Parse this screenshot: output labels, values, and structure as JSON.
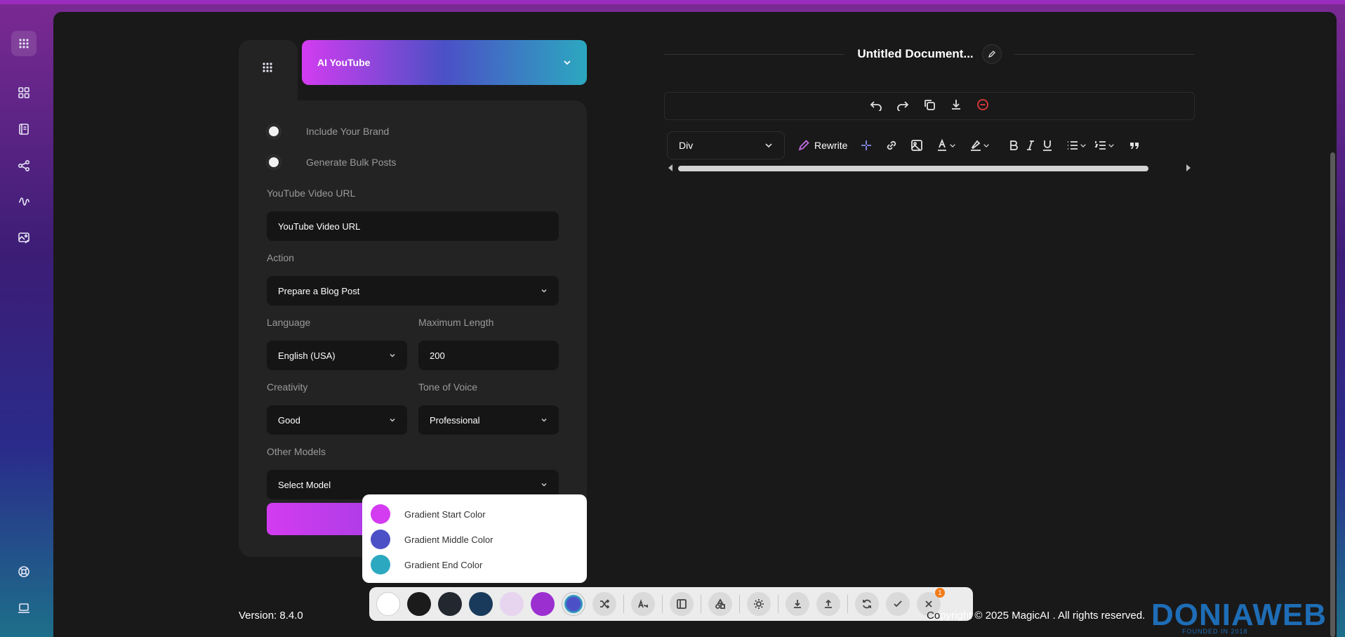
{
  "rail": {
    "icons": [
      "apps-icon",
      "grid-icon",
      "book-icon",
      "share-icon",
      "activity-icon",
      "image-edit-icon",
      "support-icon",
      "laptop-icon"
    ]
  },
  "generator": {
    "header_title": "AI YouTube",
    "toggles": [
      {
        "label": "Include Your Brand"
      },
      {
        "label": "Generate Bulk Posts"
      }
    ],
    "url_label": "YouTube Video URL",
    "url_value": "YouTube Video URL",
    "action_label": "Action",
    "action_value": "Prepare a Blog Post",
    "language_label": "Language",
    "language_value": "English (USA)",
    "maxlen_label": "Maximum Length",
    "maxlen_value": "200",
    "creativity_label": "Creativity",
    "creativity_value": "Good",
    "tone_label": "Tone of Voice",
    "tone_value": "Professional",
    "models_label": "Other Models",
    "models_value": "Select Model"
  },
  "color_popup": {
    "options": [
      {
        "label": "Gradient Start Color",
        "color": "#d33cf0"
      },
      {
        "label": "Gradient Middle Color",
        "color": "#4b50c6"
      },
      {
        "label": "Gradient End Color",
        "color": "#2ca8c0"
      }
    ]
  },
  "document": {
    "title": "Untitled Document...",
    "format_value": "Div",
    "rewrite_label": "Rewrite"
  },
  "toolbar": {
    "swatches": [
      "#ffffff",
      "#1b1b1b",
      "#23272f",
      "#1a3a5c",
      "#e7d4ef",
      "#9b2fd0"
    ],
    "badge": "1"
  },
  "footer": {
    "version": "Version: 8.4.0",
    "copyright": "pyright © 2025 MagicAI . All rights reserved.",
    "copyright_hidden": "Co",
    "logo_text": "DONIAWEB",
    "logo_sub": "FOUNDED IN 2018"
  }
}
